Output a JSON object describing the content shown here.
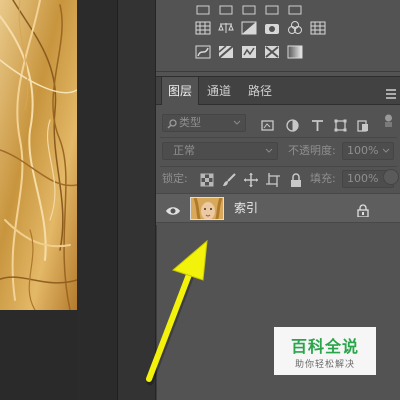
{
  "colors": {
    "panel_bg": "#535353",
    "tab_bar_bg": "#424242",
    "selected_layer_bg": "#5e5e5e",
    "arrow": "#f2f20a",
    "watermark_green": "#2aa54b"
  },
  "canvas": {
    "image": "blonde-hair-photo"
  },
  "adjustments": {
    "icons_row1": [
      "brightness-icon",
      "levels-icon",
      "curves-icon",
      "exposure-icon",
      "vibrance-icon"
    ],
    "icons_row2": [
      "hue-sat-icon",
      "color-balance-icon",
      "black-white-icon",
      "photo-filter-icon",
      "channel-mixer-icon",
      "color-lookup-icon"
    ],
    "icons_row3": [
      "invert-icon",
      "posterize-icon",
      "threshold-icon",
      "selective-color-icon",
      "gradient-map-icon"
    ]
  },
  "layers_panel": {
    "tabs": [
      {
        "label": "图层",
        "active": true
      },
      {
        "label": "通道",
        "active": false
      },
      {
        "label": "路径",
        "active": false
      }
    ],
    "filter": {
      "label": "类型",
      "icons": [
        "image-filter-icon",
        "adjustment-filter-icon",
        "type-filter-icon",
        "shape-filter-icon",
        "smart-object-filter-icon"
      ]
    },
    "blend_mode": "正常",
    "opacity_label": "不透明度:",
    "opacity_value": "100%",
    "lock_label": "锁定:",
    "lock_icons": [
      "lock-transparent-icon",
      "lock-pixels-icon",
      "lock-position-icon",
      "lock-artboard-icon",
      "lock-all-icon"
    ],
    "fill_label": "填充:",
    "fill_value": "100%",
    "layers": [
      {
        "name": "索引",
        "visible": true,
        "locked": true,
        "selected": true
      }
    ]
  },
  "watermark": {
    "title": "百科全说",
    "subtitle": "助你轻松解决"
  }
}
